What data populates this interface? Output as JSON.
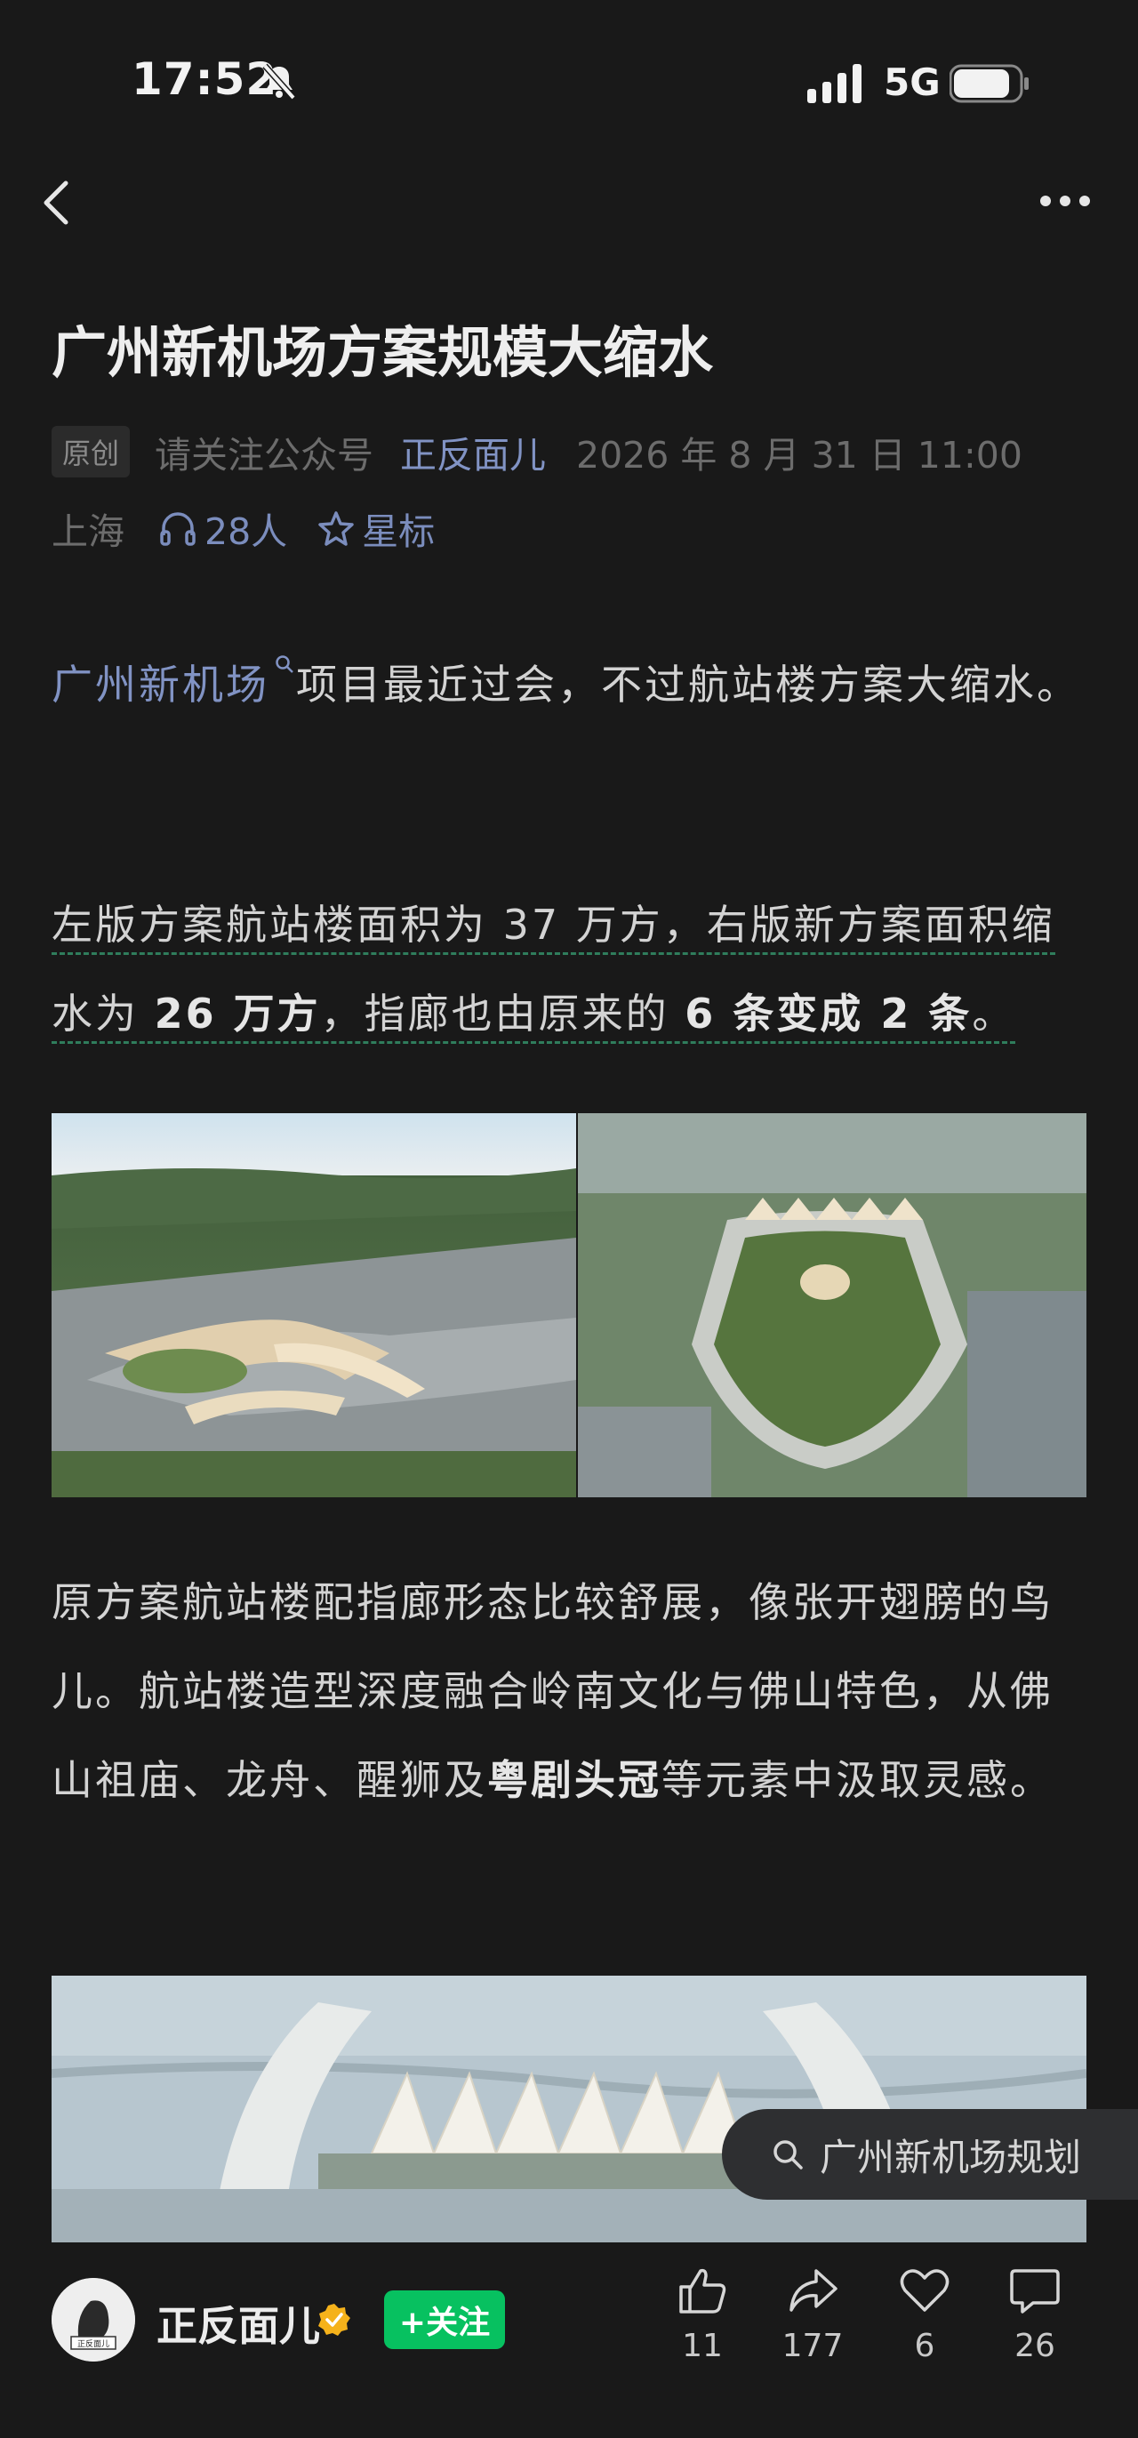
{
  "status_bar": {
    "time": "17:52",
    "network": "5G"
  },
  "article": {
    "title": "广州新机场方案规模大缩水",
    "badge": "原创",
    "source_prefix": "请关注公众号",
    "account": "正反面儿",
    "datetime": "2026 年 8 月 31 日 11:00",
    "location": "上海",
    "listeners": "28人",
    "star_label": "星标",
    "p1_link": "广州新机场",
    "p1_rest": "项目最近过会，不过航站楼方案大缩水。",
    "p2_a": "左版方案航站楼面积为 37 万方，右版新方案面积缩水为 ",
    "p2_b": "26 万方",
    "p2_c": "，指廊也由原来的 ",
    "p2_d": "6 条变成 2 条",
    "p2_e": "。",
    "p3_a": "原方案航站楼配指廊形态比较舒展，像张开翅膀的鸟儿。航站楼造型深度融合岭南文化与佛山特色，从佛山祖庙、龙舟、醒狮及",
    "p3_b": "粤剧头冠",
    "p3_c": "等元素中汲取灵感。"
  },
  "search_chip": {
    "label": "广州新机场规划"
  },
  "bottom_bar": {
    "author": "正反面儿",
    "avatar_text": "正反面儿",
    "follow_label": "+关注",
    "actions": [
      {
        "icon": "thumbs-up-icon",
        "count": "11"
      },
      {
        "icon": "share-icon",
        "count": "177"
      },
      {
        "icon": "heart-icon",
        "count": "6"
      },
      {
        "icon": "comment-icon",
        "count": "26"
      }
    ]
  },
  "colors": {
    "background": "#191919",
    "link": "#8193c4",
    "follow": "#07c160",
    "underline": "#2f7d5c"
  }
}
